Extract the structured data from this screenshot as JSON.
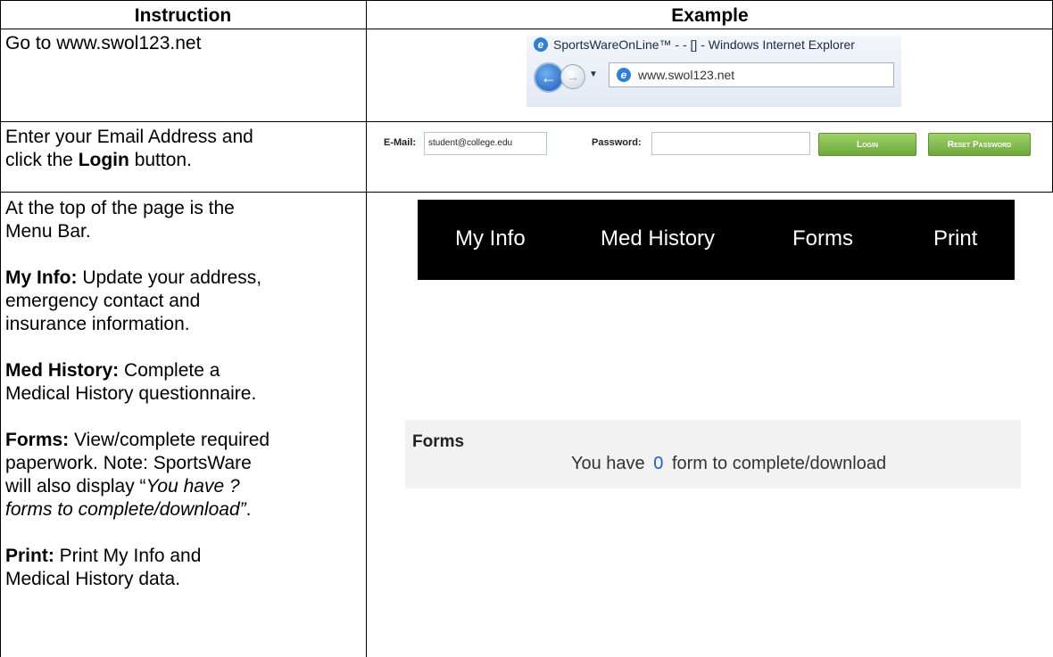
{
  "headers": {
    "instruction": "Instruction",
    "example": "Example"
  },
  "rows": {
    "r1": {
      "text": "Go to www.swol123.net"
    },
    "r2": {
      "line1": "Enter your Email Address and",
      "line2_pre": "click the ",
      "line2_bold": "Login",
      "line2_post": " button."
    },
    "r3": {
      "p1_l1": "At the top of the page is the",
      "p1_l2": "Menu Bar.",
      "myinfo_bold": "My Info:",
      "myinfo_l1": " Update your address,",
      "myinfo_l2": "emergency contact and",
      "myinfo_l3": "insurance information.",
      "med_bold": "Med History:",
      "med_l1": " Complete a",
      "med_l2": "Medical History questionnaire.",
      "forms_bold": "Forms:",
      "forms_l1": " View/complete required",
      "forms_l2": "paperwork. Note: SportsWare",
      "forms_l3_pre": "will also display “",
      "forms_l3_ital": "You have ?",
      "forms_l4_ital": "forms to complete/download”",
      "forms_l4_post": ".",
      "print_bold": "Print:",
      "print_l1": " Print My Info and",
      "print_l2": "Medical History data."
    }
  },
  "browser": {
    "title": "SportsWareOnLine™ - - [] - Windows Internet Explorer",
    "url": "www.swol123.net",
    "ie_icon": "e",
    "back_icon": "←",
    "forward_icon": "→",
    "dropdown_icon": "▼"
  },
  "login": {
    "email_label": "E-Mail:",
    "email_value": "student@college.edu",
    "password_label": "Password:",
    "password_value": "",
    "login_button": "Login",
    "reset_button": "Reset Password"
  },
  "menubar": {
    "items": [
      "My Info",
      "Med History",
      "Forms",
      "Print"
    ]
  },
  "forms_panel": {
    "title": "Forms",
    "prefix": "You have",
    "count": "0",
    "suffix": "form to complete/download"
  },
  "colors": {
    "menubar_bg": "#000000",
    "login_button": "#7fbd4a",
    "forms_count": "#1f5fbf"
  }
}
